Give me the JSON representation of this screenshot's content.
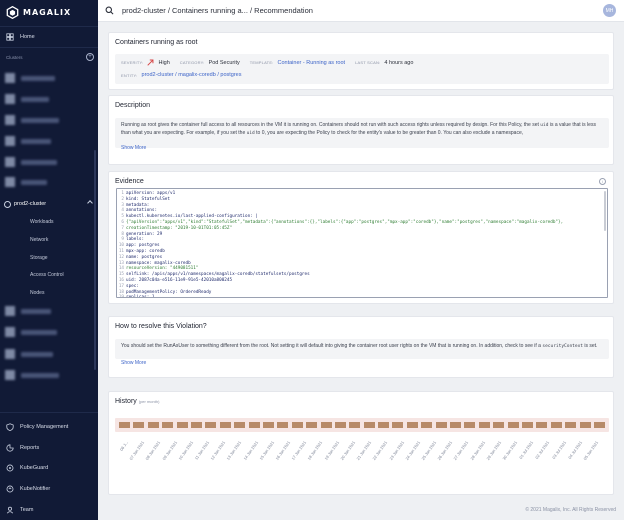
{
  "brand": {
    "name": "MAGALIX"
  },
  "sidebar": {
    "home_label": "Home",
    "clusters_label": "Clusters",
    "active_cluster": "prod2-cluster",
    "sub_items": [
      "Workloads",
      "Network",
      "Storage",
      "Access Control",
      "Nodes"
    ],
    "bottom_items": [
      {
        "label": "Policy Management",
        "icon": "shield-icon"
      },
      {
        "label": "Reports",
        "icon": "chart-icon"
      },
      {
        "label": "KubeGuard",
        "icon": "kubeguard-icon"
      },
      {
        "label": "KubeNotifier",
        "icon": "bell-icon"
      },
      {
        "label": "Team",
        "icon": "team-icon"
      }
    ]
  },
  "topbar": {
    "breadcrumb": "prod2-cluster / Containers running a... / Recommendation",
    "avatar_initials": "MH"
  },
  "summary": {
    "title": "Containers running as root",
    "severity_key": "SEVERITY:",
    "severity_val": "High",
    "category_key": "CATEGORY:",
    "category_val": "Pod Security",
    "template_key": "TEMPLATE:",
    "template_val": "Container - Running as root",
    "lastscan_key": "LAST SCAN:",
    "lastscan_val": "4 hours ago",
    "entity_key": "ENTITY:",
    "entity_val": "prod2-cluster / magalix-coredb / postgres"
  },
  "description": {
    "title": "Description",
    "text_1": "Running as root gives the container full access to all resources in the VM it is running on. Containers should not run with such access rights unless required by design. For this Policy, the set ",
    "code_1": "uid",
    "text_2": " is a value that is less than what you are expecting. For example, if you set the ",
    "code_2": "uid",
    "text_3": " to 0, you are expecting the Policy to check for the entity's value to be greater than 0. You can also exclude a namespace,",
    "show_more": "Show More"
  },
  "evidence": {
    "title": "Evidence",
    "info_icon": "i",
    "lines": [
      "apiVersion: apps/v1",
      "kind: StatefulSet",
      "metadata:",
      "  annotations:",
      "    kubectl.kubernetes.io/last-applied-configuration: |",
      "      {\"apiVersion\":\"apps/v1\",\"kind\":\"StatefulSet\",\"metadata\":{\"annotations\":{},\"labels\":{\"app\":\"postgres\",\"mpx-app\":\"coredb\"},\"name\":\"postgres\",\"namespace\":\"magalix-coredb\"},",
      "  creationTimestamp: \"2019-10-01T01:05:45Z\"",
      "  generation: 29",
      "  labels:",
      "    app: postgres",
      "    mpx-app: coredb",
      "  name: postgres",
      "  namespace: magalix-coredb",
      "  resourceVersion: \"449081511\"",
      "  selfLink: /apis/apps/v1/namespaces/magalix-coredb/statefulsets/postgres",
      "  uid: 2087c04a-e516-11e9-91e5-42010a800245",
      "spec:",
      "  podManagementPolicy: OrderedReady",
      "  replicas: 1"
    ]
  },
  "resolve": {
    "title": "How to resolve this Violation?",
    "text_1": "You should set the RunAsUser to something different from the root. Not setting it will default into giving the container root user rights on the VM that is running on. In addition, check to see if a ",
    "code_1": "securityContext",
    "text_2": " is set.",
    "show_more": "Show More"
  },
  "history": {
    "title": "History",
    "subtitle": "(per month)",
    "dates": [
      "06 J...",
      "07 Jan 2021",
      "08 Jan 2021",
      "09 Jan 2021",
      "10 Jan 2021",
      "11 Jan 2021",
      "12 Jan 2021",
      "13 Jan 2021",
      "14 Jan 2021",
      "15 Jan 2021",
      "16 Jan 2021",
      "17 Jan 2021",
      "18 Jan 2021",
      "19 Jan 2021",
      "20 Jan 2021",
      "21 Jan 2021",
      "22 Jan 2021",
      "23 Jan 2021",
      "24 Jan 2021",
      "25 Jan 2021",
      "26 Jan 2021",
      "27 Jan 2021",
      "28 Jan 2021",
      "29 Jan 2021",
      "30 Jan 2021",
      "01 Jul 2021",
      "02 Jul 2021",
      "03 Jul 2021",
      "04 Jul 2021",
      "05 Jan 2021"
    ],
    "cell_count": 34,
    "cell_color": "#b78a68",
    "strip_color": "#f6e5e3"
  },
  "footer": {
    "copyright": "© 2021 Magalix, Inc. All Rights Reserved"
  },
  "colors": {
    "sidebar_bg": "#111a36",
    "link": "#3d64c8",
    "severity_high": "#d64545"
  }
}
